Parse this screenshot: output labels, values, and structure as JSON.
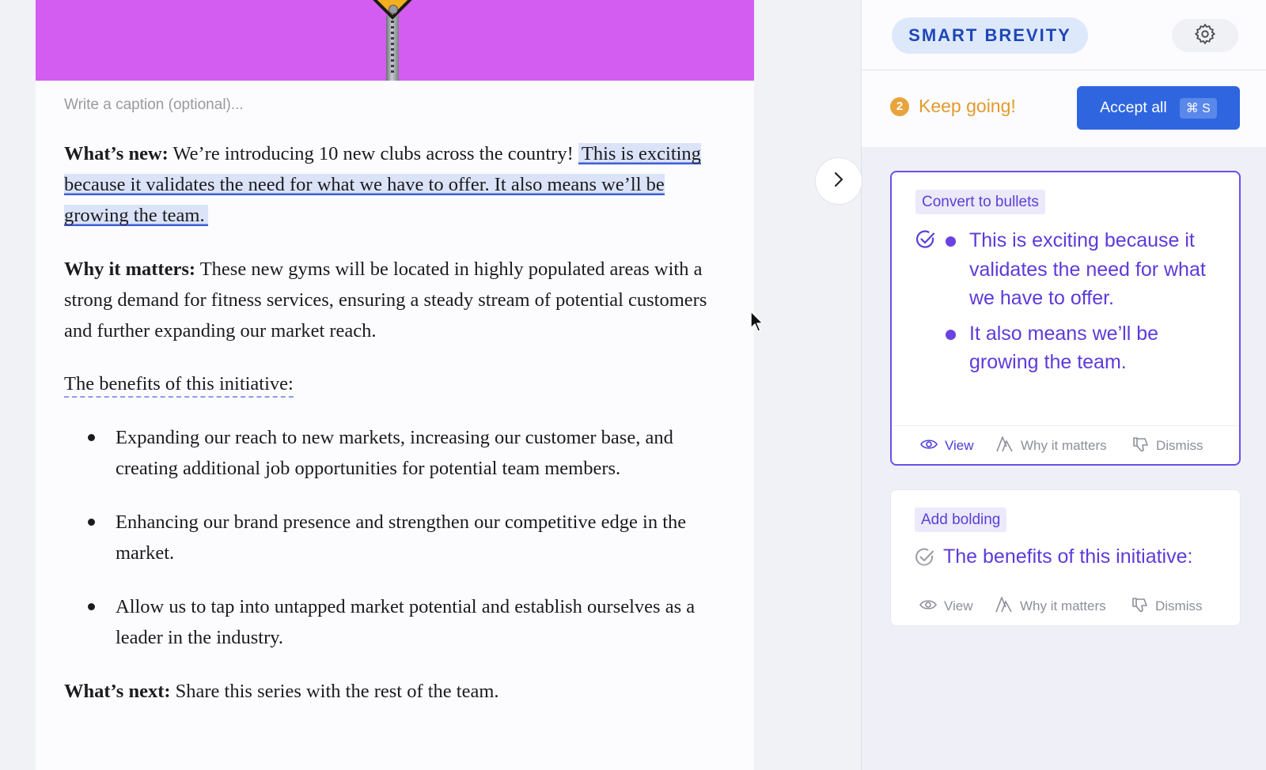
{
  "editor": {
    "caption_placeholder": "Write a caption (optional)...",
    "whats_new": {
      "label": "What’s new:",
      "text": " We’re introducing 10 new clubs across the country! ",
      "highlight": "This is exciting because it validates the need for what we have to offer. It also means we’ll be growing the team."
    },
    "why_it_matters": {
      "label": "Why it matters:",
      "text": " These new gyms will be located in highly populated areas with a strong demand for fitness services, ensuring a steady stream of potential customers and further expanding our market reach."
    },
    "benefits_title": "The benefits of this initiative:",
    "bullets": [
      "Expanding our reach to new markets, increasing our customer base, and creating additional job opportunities for potential team members.",
      "Enhancing our brand presence and strengthen our competitive edge in the market.",
      "Allow us to tap into untapped market potential and establish ourselves as a leader in the industry."
    ],
    "whats_next": {
      "label": "What’s next:",
      "text": " Share this series with the rest of the team."
    }
  },
  "panel": {
    "title": "SMART BREVITY",
    "status_count": "2",
    "status_text": "Keep going!",
    "accept_all_label": "Accept all",
    "accept_all_shortcut": "⌘ S",
    "suggestions": [
      {
        "tag": "Convert to bullets",
        "bullets": [
          "This is exciting because it validates the need for what we have to offer.",
          "It also means we’ll be growing the team."
        ],
        "view": "View",
        "why": "Why it matters",
        "dismiss": "Dismiss"
      },
      {
        "tag": "Add bolding",
        "text": "The benefits of this initiative:",
        "view": "View",
        "why": "Why it matters",
        "dismiss": "Dismiss"
      }
    ]
  },
  "colors": {
    "hero": "#d35df0",
    "accent_blue": "#2f66e0",
    "suggestion_purple": "#5e3ad9",
    "status_orange": "#e39a2c"
  },
  "icons": [
    "warning-sign-image",
    "chevron-right-icon",
    "cursor-icon",
    "gear-icon",
    "check-circle-icon",
    "eye-icon",
    "why-it-matters-icon",
    "thumbs-down-icon"
  ]
}
